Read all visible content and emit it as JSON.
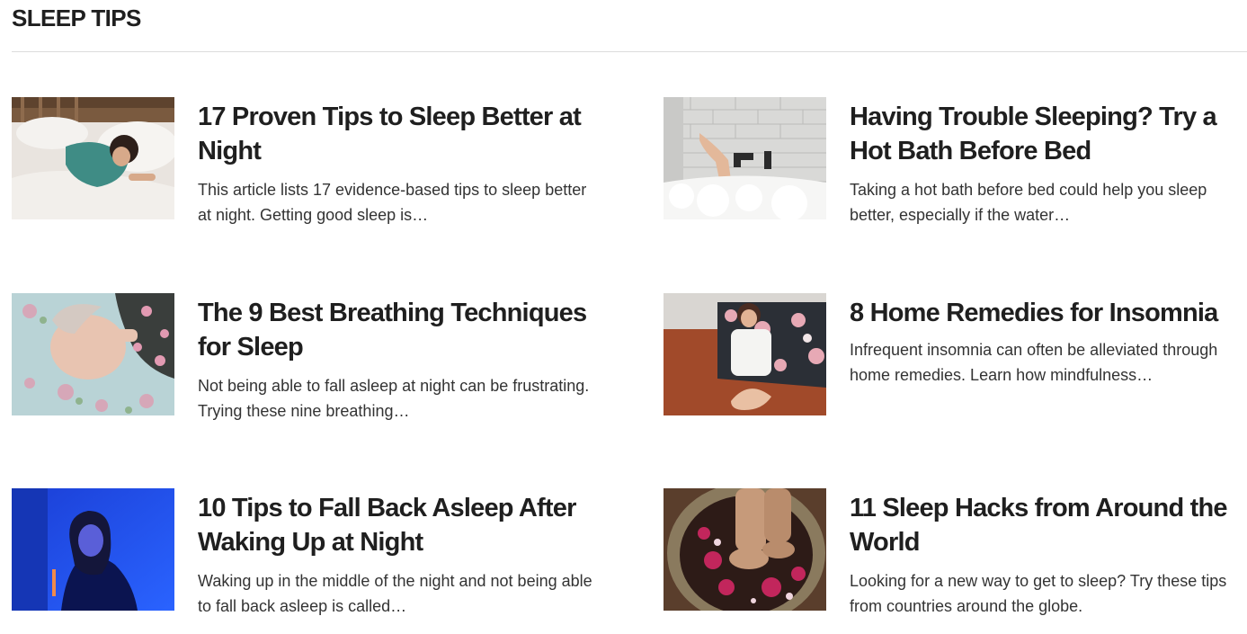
{
  "section": {
    "title": "SLEEP TIPS"
  },
  "articles": [
    {
      "title": "17 Proven Tips to Sleep Better at Night",
      "summary": "This article lists 17 evidence-based tips to sleep better at night. Getting good sleep is…",
      "image_icon": "woman-sleeping-image"
    },
    {
      "title": "Having Trouble Sleeping? Try a Hot Bath Before Bed",
      "summary": "Taking a hot bath before bed could help you sleep better, especially if the water…",
      "image_icon": "bubble-bath-image"
    },
    {
      "title": "The 9 Best Breathing Techniques for Sleep",
      "summary": "Not being able to fall asleep at night can be frustrating. Trying these nine breathing…",
      "image_icon": "person-lying-floral-image"
    },
    {
      "title": "8 Home Remedies for Insomnia",
      "summary": "Infrequent insomnia can often be alleviated through home remedies. Learn how mindfulness…",
      "image_icon": "woman-meditating-image"
    },
    {
      "title": "10 Tips to Fall Back Asleep After Waking Up at Night",
      "summary": "Waking up in the middle of the night and not being able to fall back asleep is called…",
      "image_icon": "woman-blue-light-image"
    },
    {
      "title": "11 Sleep Hacks from Around the World",
      "summary": "Looking for a new way to get to sleep? Try these tips from countries around the globe.",
      "image_icon": "foot-bath-flowers-image"
    }
  ],
  "colors": {
    "title_text": "#1f1f1f",
    "body_text": "#333333",
    "divider": "#dcdcdc"
  }
}
